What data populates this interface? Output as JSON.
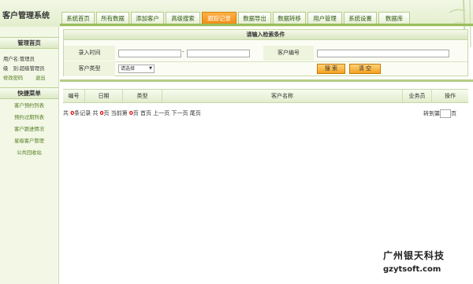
{
  "app": {
    "title": "客户管理系统"
  },
  "nav": {
    "tabs": [
      {
        "label": "系统首页"
      },
      {
        "label": "所有数据"
      },
      {
        "label": "添加客户"
      },
      {
        "label": "高级搜索"
      },
      {
        "label": "跟踪记录"
      },
      {
        "label": "数据导出"
      },
      {
        "label": "数据转移"
      },
      {
        "label": "用户管理"
      },
      {
        "label": "系统设置"
      },
      {
        "label": "数据库"
      }
    ],
    "active_index": 4
  },
  "sidebar": {
    "section1_title": "管理首页",
    "username_line": "用户名:管理员",
    "role_line": "级　别:超级管理员",
    "change_password": "修改密码",
    "logout": "退出",
    "section2_title": "快捷菜单",
    "items": [
      {
        "label": "客户预约列表"
      },
      {
        "label": "预约过期列表"
      },
      {
        "label": "客户跟进情况"
      },
      {
        "label": "星级客户管理"
      },
      {
        "label": "公共回收站"
      }
    ]
  },
  "search": {
    "title": "请输入检索条件",
    "entry_time_label": "录入时间",
    "date_separator": "-",
    "customer_no_label": "客户编号",
    "customer_type_label": "客户类型",
    "type_select_value": "请选择",
    "search_button": "搜 索",
    "clear_button": "清 空"
  },
  "table": {
    "headers": [
      "编号",
      "日期",
      "类型",
      "客户名称",
      "业务员",
      "操作"
    ]
  },
  "pager": {
    "prefix": "共",
    "total_records": "0",
    "records_suffix": "条记录 共",
    "total_pages": "0",
    "pages_suffix": "页 当前第",
    "current_page": "0",
    "current_suffix": "页",
    "first": "首页",
    "prev": "上一页",
    "next": "下一页",
    "last": "尾页",
    "goto_label": "转到第",
    "goto_suffix": "页"
  },
  "watermark": {
    "line1": "广州银天科技",
    "line2": "gzytsoft.com"
  },
  "colors": {
    "accent_green": "#9bbd5c",
    "active_tab": "#f08a10",
    "button_orange": "#f4a21e",
    "count_red": "#e00000"
  }
}
